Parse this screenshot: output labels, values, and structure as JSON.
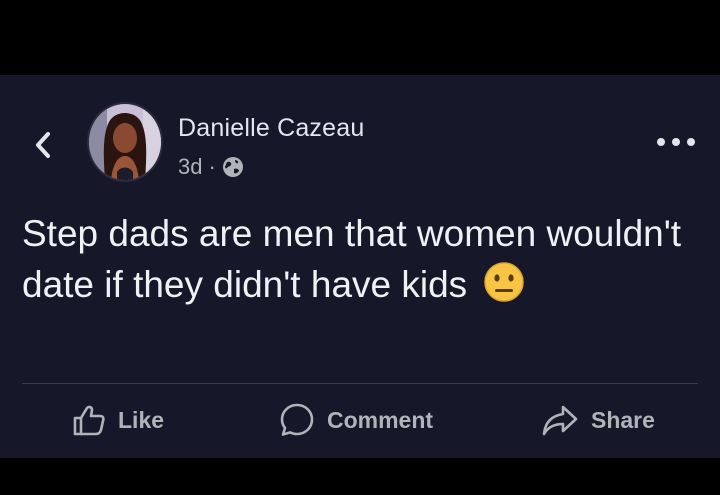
{
  "post": {
    "author": "Danielle Cazeau",
    "time": "3d",
    "separator": "·",
    "audience_icon": "globe-icon",
    "text_before_emoji": "Step dads are men that women wouldn't date if they didn't have kids",
    "emoji": "neutral-face-emoji"
  },
  "actions": {
    "like_label": "Like",
    "comment_label": "Comment",
    "share_label": "Share"
  },
  "colors": {
    "background": "#17172a",
    "text": "#e4e6eb",
    "secondary_text": "#b0b3b8",
    "emoji_yellow": "#f7c443"
  }
}
